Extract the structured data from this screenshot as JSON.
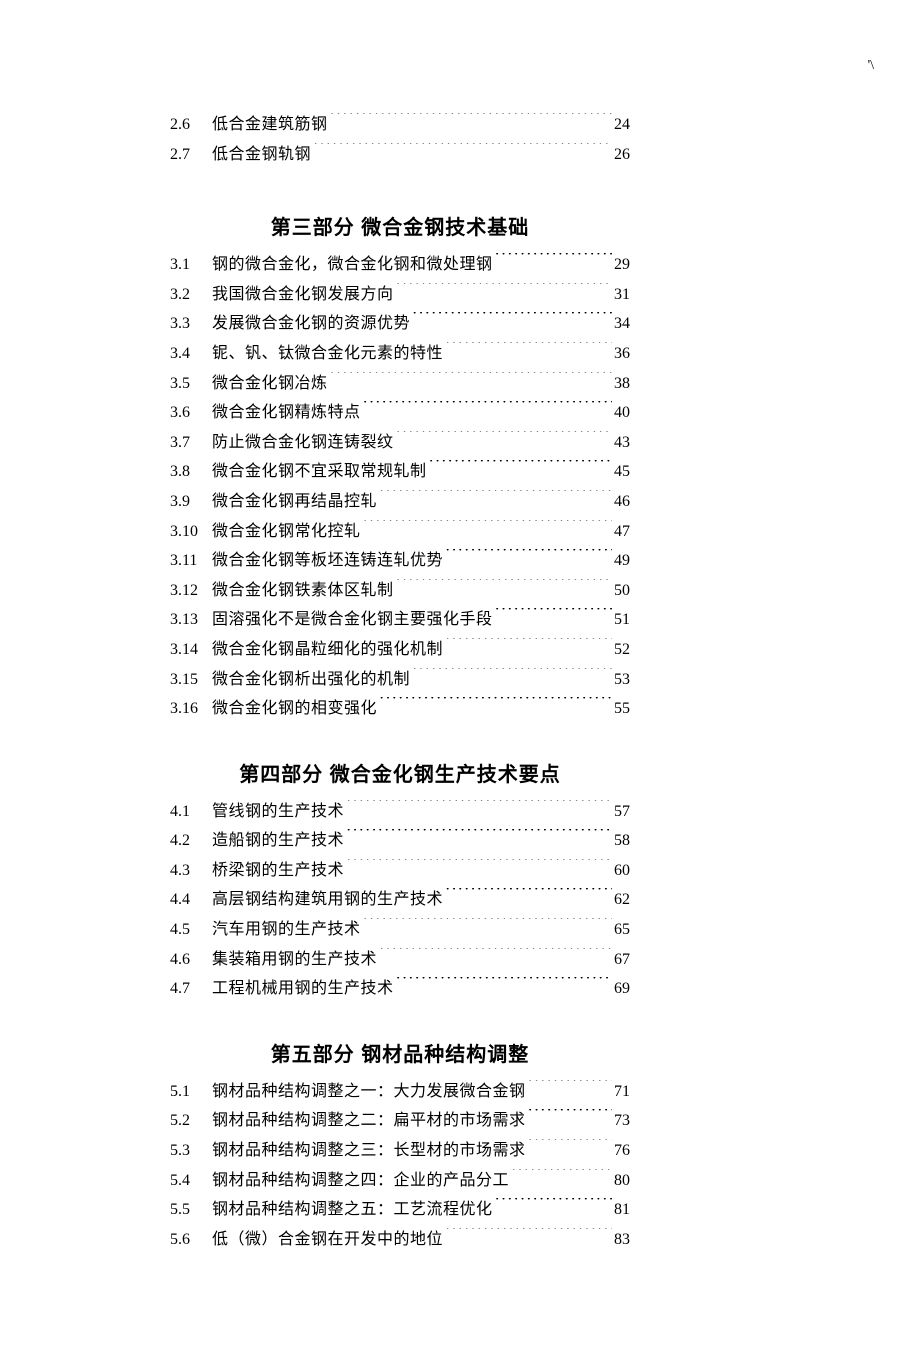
{
  "page_mark": "'\\",
  "pre_entries": [
    {
      "num": "2.6",
      "title": "低合金建筑筋钢",
      "page": "24"
    },
    {
      "num": "2.7",
      "title": "低合金钢轨钢",
      "page": "26"
    }
  ],
  "sections": [
    {
      "heading": "第三部分  微合金钢技术基础",
      "entries": [
        {
          "num": "3.1",
          "title": "钢的微合金化，微合金化钢和微处理钢",
          "page": "29"
        },
        {
          "num": "3.2",
          "title": "我国微合金化钢发展方向",
          "page": "31"
        },
        {
          "num": "3.3",
          "title": "发展微合金化钢的资源优势",
          "page": "34"
        },
        {
          "num": "3.4",
          "title": "铌、钒、钛微合金化元素的特性",
          "page": "36"
        },
        {
          "num": "3.5",
          "title": "微合金化钢冶炼",
          "page": "38"
        },
        {
          "num": "3.6",
          "title": "微合金化钢精炼特点",
          "page": "40"
        },
        {
          "num": "3.7",
          "title": "防止微合金化钢连铸裂纹",
          "page": "43"
        },
        {
          "num": "3.8",
          "title": "微合金化钢不宜采取常规轧制",
          "page": "45"
        },
        {
          "num": "3.9",
          "title": "微合金化钢再结晶控轧",
          "page": "46"
        },
        {
          "num": "3.10",
          "title": "微合金化钢常化控轧",
          "page": "47"
        },
        {
          "num": "3.11",
          "title": "微合金化钢等板坯连铸连轧优势",
          "page": "49"
        },
        {
          "num": "3.12",
          "title": "微合金化钢铁素体区轧制",
          "page": "50"
        },
        {
          "num": "3.13",
          "title": "固溶强化不是微合金化钢主要强化手段",
          "page": "51"
        },
        {
          "num": "3.14",
          "title": "微合金化钢晶粒细化的强化机制",
          "page": "52"
        },
        {
          "num": "3.15",
          "title": "微合金化钢析出强化的机制",
          "page": "53"
        },
        {
          "num": "3.16",
          "title": "微合金化钢的相变强化",
          "page": "55"
        }
      ]
    },
    {
      "heading": "第四部分  微合金化钢生产技术要点",
      "entries": [
        {
          "num": "4.1",
          "title": "管线钢的生产技术",
          "page": "57"
        },
        {
          "num": "4.2",
          "title": "造船钢的生产技术",
          "page": "58"
        },
        {
          "num": "4.3",
          "title": "桥梁钢的生产技术",
          "page": "60"
        },
        {
          "num": "4.4",
          "title": "高层钢结构建筑用钢的生产技术",
          "page": "62"
        },
        {
          "num": "4.5",
          "title": "汽车用钢的生产技术",
          "page": "65"
        },
        {
          "num": "4.6",
          "title": "集装箱用钢的生产技术",
          "page": "67"
        },
        {
          "num": "4.7",
          "title": "工程机械用钢的生产技术",
          "page": "69"
        }
      ]
    },
    {
      "heading": "第五部分  钢材品种结构调整",
      "entries": [
        {
          "num": "5.1",
          "title": "钢材品种结构调整之一：大力发展微合金钢",
          "page": "71"
        },
        {
          "num": "5.2",
          "title": "钢材品种结构调整之二：扁平材的市场需求",
          "page": "73"
        },
        {
          "num": "5.3",
          "title": "钢材品种结构调整之三：长型材的市场需求",
          "page": "76"
        },
        {
          "num": "5.4",
          "title": "钢材品种结构调整之四：企业的产品分工",
          "page": "80"
        },
        {
          "num": "5.5",
          "title": "钢材品种结构调整之五：工艺流程优化",
          "page": "81"
        },
        {
          "num": "5.6",
          "title": "低（微）合金钢在开发中的地位",
          "page": "83"
        }
      ]
    }
  ]
}
